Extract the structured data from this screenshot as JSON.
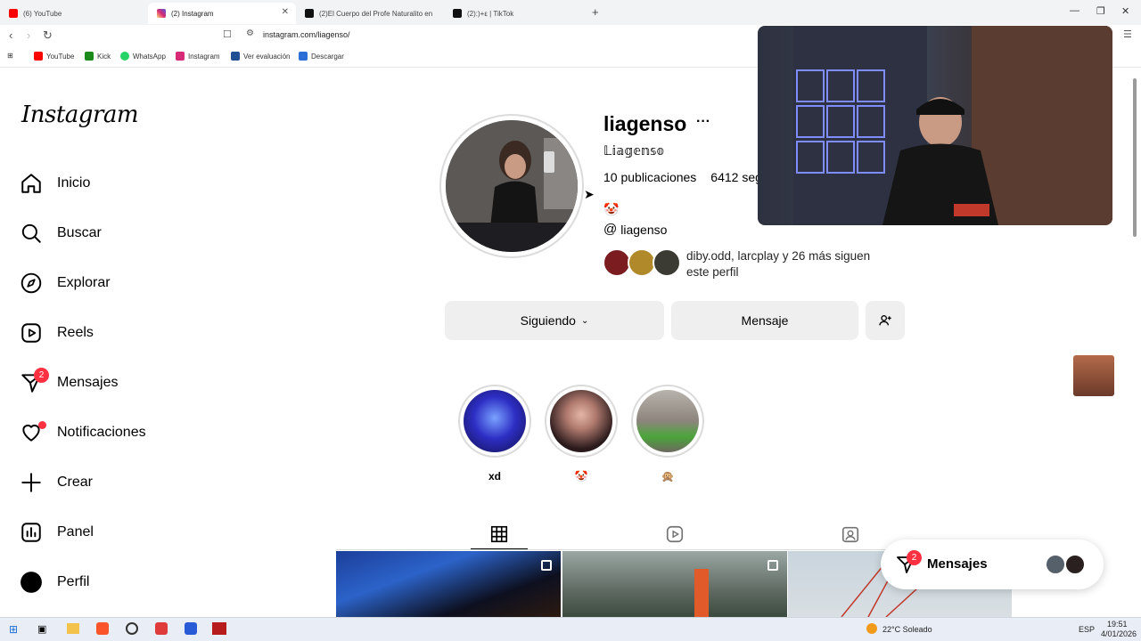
{
  "browser": {
    "tabs": [
      {
        "label": "(6) YouTube",
        "color": "#ff0000"
      },
      {
        "label": "(2) Instagram",
        "color": "#d62976",
        "active": true
      },
      {
        "label": "(2)El Cuerpo del Profe Naturalito en",
        "color": "#111111"
      },
      {
        "label": "(2):)+ε | TikTok",
        "color": "#111111"
      }
    ],
    "url": "instagram.com/liagenso/",
    "bookmarks": [
      {
        "label": "YouTube",
        "color": "#ff0000"
      },
      {
        "label": "Kick",
        "color": "#1b8a1b"
      },
      {
        "label": "WhatsApp",
        "color": "#25d366"
      },
      {
        "label": "Instagram",
        "color": "#d62976"
      },
      {
        "label": "Ver evaluación",
        "color": "#1d4f91"
      },
      {
        "label": "Descargar",
        "color": "#2b6fd6"
      }
    ]
  },
  "sidebar": {
    "logo": "Instagram",
    "items": [
      {
        "label": "Inicio",
        "icon": "home-icon"
      },
      {
        "label": "Buscar",
        "icon": "search-icon"
      },
      {
        "label": "Explorar",
        "icon": "compass-icon"
      },
      {
        "label": "Reels",
        "icon": "reels-icon"
      },
      {
        "label": "Mensajes",
        "icon": "messenger-icon",
        "badge": "2"
      },
      {
        "label": "Notificaciones",
        "icon": "heart-icon"
      },
      {
        "label": "Crear",
        "icon": "plus-icon"
      },
      {
        "label": "Panel",
        "icon": "chart-icon"
      },
      {
        "label": "Perfil",
        "icon": "avatar-icon"
      }
    ]
  },
  "profile": {
    "username": "liagenso",
    "more": "···",
    "full_name": "𝕃𝕚𝕒𝕘𝕖𝕟𝕤𝕠",
    "posts": "10 publicaciones",
    "followers_partial": "6412 seg",
    "bio_emoji": "🤡",
    "threads_handle": "liagenso",
    "followed_by": "diby.odd, larcplay y 26 más siguen este perfil",
    "following_button": "Siguiendo",
    "message_button": "Mensaje"
  },
  "highlights": [
    {
      "label": "xd",
      "color": "#2d2ec4"
    },
    {
      "label": "🤡",
      "color": "#3a2a2a"
    },
    {
      "label": "🙊",
      "color": "#9a8f86"
    }
  ],
  "floating_messages": {
    "label": "Mensajes",
    "badge": "2"
  },
  "taskbar": {
    "weather": "22°C Soleado",
    "lang": "ESP",
    "time": "19:51",
    "date": "4/01/2026"
  }
}
